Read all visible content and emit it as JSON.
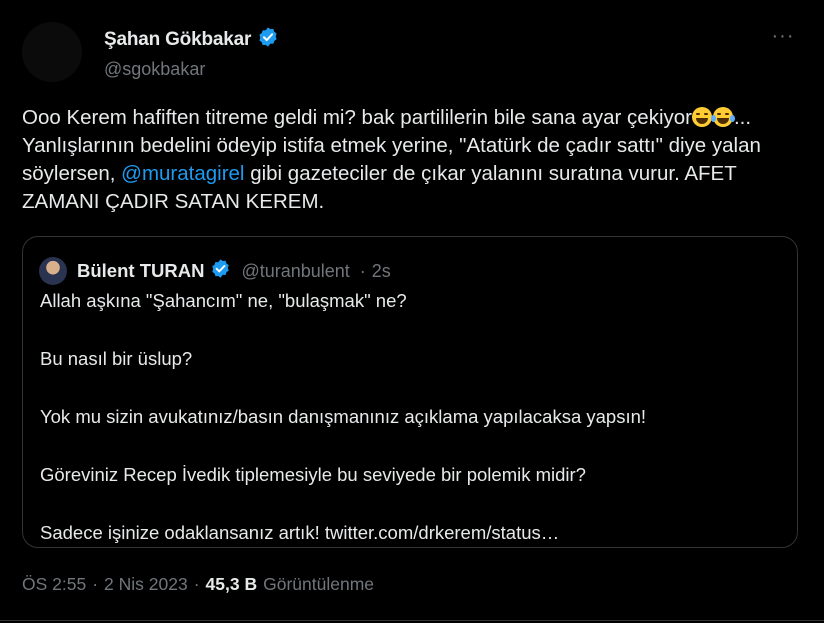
{
  "tweet": {
    "author_name": "Şahan Gökbakar",
    "author_handle": "@sgokbakar",
    "text_part1": "Ooo Kerem hafiften titreme geldi mi? bak partililerin bile sana ayar çekiyor",
    "text_part2": "... Yanlışlarının bedelini ödeyip istifa etmek yerine, \"Atatürk de çadır sattı\" diye yalan söylersen, ",
    "mention": "@muratagirel",
    "text_part3": " gibi gazeteciler de çıkar yalanını suratına vurur. AFET ZAMANI ÇADIR SATAN KEREM.",
    "emojis": [
      "grinning-face-emoji",
      "face-with-tears-of-joy-emoji"
    ],
    "more_label": "···"
  },
  "quote": {
    "author_name": "Bülent TURAN",
    "author_handle": "@turanbulent",
    "separator": "·",
    "time": "2s",
    "lines": [
      "Allah aşkına \"Şahancım\" ne, \"bulaşmak\" ne?",
      "Bu nasıl bir üslup?",
      "Yok mu sizin avukatınız/basın danışmanınız açıklama yapılacaksa yapsın!",
      "Göreviniz Recep İvedik tiplemesiyle bu seviyede bir polemik midir?",
      "Sadece işinize odaklansanız artık! twitter.com/drkerem/status…"
    ]
  },
  "meta": {
    "time": "ÖS 2:55",
    "separator": "·",
    "date": "2 Nis 2023",
    "views_count": "45,3 B",
    "views_label": "Görüntülenme"
  },
  "colors": {
    "background": "#000000",
    "text": "#e7e9ea",
    "muted": "#71767b",
    "accent": "#1d9bf0",
    "border": "#2f3336"
  }
}
